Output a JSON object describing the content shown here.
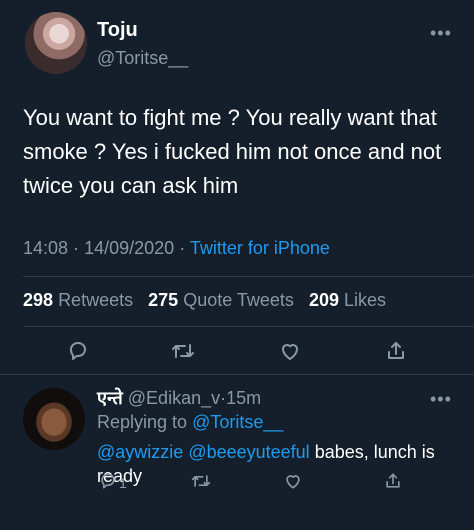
{
  "main_tweet": {
    "display_name": "Toju",
    "handle": "@Toritse__",
    "text": "You want to fight me ? You really want that smoke ? Yes i fucked him not once and not twice you can ask him",
    "time": "14:08",
    "separator": "·",
    "date": "14/09/2020",
    "source": "Twitter for iPhone",
    "stats": {
      "retweets_count": "298",
      "retweets_label": "Retweets",
      "quote_count": "275",
      "quote_label": "Quote Tweets",
      "likes_count": "209",
      "likes_label": "Likes"
    },
    "icons": [
      "reply-icon",
      "retweet-icon",
      "like-icon",
      "share-icon",
      "more-icon"
    ]
  },
  "reply": {
    "display_name": "एन्ते",
    "handle": "@Edikan_v",
    "separator": "·",
    "time_ago": "15m",
    "replying_prefix": "Replying to",
    "replying_to": "@Toritse__",
    "mention_1": "@aywizzie",
    "mention_2": "@beeeyuteeful",
    "text": "babes, lunch is ready",
    "reply_count": "1"
  },
  "colors": {
    "background": "#151f2b",
    "text": "#ffffff",
    "secondary": "#8a98a6",
    "link": "#1d9bf0",
    "divider": "#2c3a49"
  }
}
